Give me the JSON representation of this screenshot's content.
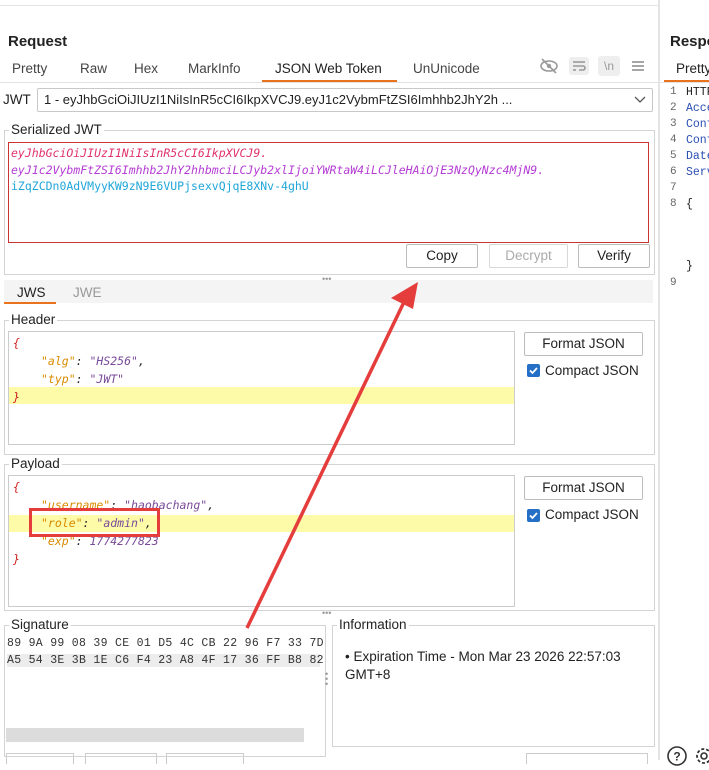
{
  "request": {
    "title": "Request",
    "tabs": [
      "Pretty",
      "Raw",
      "Hex",
      "MarkInfo",
      "JSON Web Token",
      "UnUnicode"
    ],
    "active_tab": "JSON Web Token",
    "icons": [
      "eye-slash-icon",
      "wrap-lines-icon",
      "newline-icon",
      "menu-icon"
    ],
    "newline_label": "\\n"
  },
  "jwt": {
    "label": "JWT",
    "selected": "1 - eyJhbGciOiJIUzI1NiIsInR5cCI6IkpXVCJ9.eyJ1c2VybmFtZSI6Imhhb2JhY2h ..."
  },
  "serialized": {
    "label": "Serialized JWT",
    "header_part": "eyJhbGciOiJIUzI1NiIsInR5cCI6IkpXVCJ9.",
    "payload_part": "eyJ1c2VybmFtZSI6Imhhb2JhY2hhbmciLCJyb2xlIjoiYWRtaW4iLCJleHAiOjE3NzQyNzc4MjN9.",
    "signature_part": "iZqZCDn0AdVMyyKW9zN9E6VUPjsexvQjqE8XNv-4ghU",
    "buttons": [
      "Copy",
      "Decrypt",
      "Verify"
    ]
  },
  "subtabs": [
    "JWS",
    "JWE"
  ],
  "header_box": {
    "label": "Header",
    "lines": [
      {
        "open": "{"
      },
      {
        "key": "\"alg\"",
        "sep": ": ",
        "val": "\"HS256\"",
        "end": ","
      },
      {
        "key": "\"typ\"",
        "sep": ": ",
        "val": "\"JWT\"",
        "end": ""
      },
      {
        "close": "}"
      }
    ],
    "format_button": "Format JSON",
    "compact_label": "Compact JSON",
    "compact_checked": true
  },
  "payload_box": {
    "label": "Payload",
    "lines": [
      {
        "open": "{"
      },
      {
        "key": "\"username\"",
        "sep": ": ",
        "val": "\"haobachang\"",
        "end": ","
      },
      {
        "key": "\"role\"",
        "sep": ": ",
        "val": "\"admin\"",
        "end": ","
      },
      {
        "key": "\"exp\"",
        "sep": ": ",
        "val": "1774277823",
        "end": ""
      },
      {
        "close": "}"
      }
    ],
    "format_button": "Format JSON",
    "compact_label": "Compact JSON",
    "compact_checked": true
  },
  "signature": {
    "label": "Signature",
    "row1": "89 9A 99 08 39 CE 01 D5 4C CB 22 96 F7 33 7D",
    "row2": "A5 54 3E 3B 1E C6 F4 23 A8 4F 17 36 FF B8 82"
  },
  "information": {
    "label": "Information",
    "text": "• Expiration Time - Mon Mar 23 2026 22:57:03 GMT+8"
  },
  "response": {
    "title": "Respo",
    "tab": "Pretty",
    "line_numbers": [
      "1",
      "2",
      "3",
      "4",
      "5",
      "6",
      "7",
      "8",
      "9"
    ],
    "lines": [
      "HTTP",
      "Acce",
      "Conf",
      "Conf",
      "Date",
      "Serv",
      "",
      "{",
      "",
      "}"
    ]
  },
  "colors": {
    "accent": "#e8731a",
    "annotation_red": "#e53c3c",
    "highlight": "#fdfaa8"
  }
}
